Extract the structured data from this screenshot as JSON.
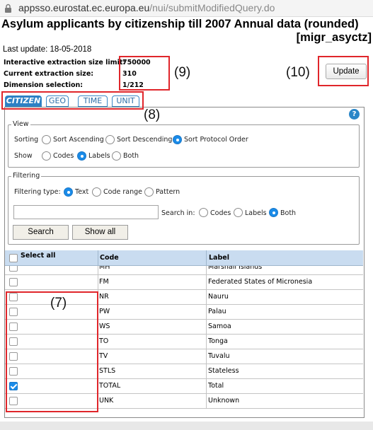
{
  "browser": {
    "url_host": "appsso.eurostat.ec.europa.eu",
    "url_path": "/nui/submitModifiedQuery.do"
  },
  "page": {
    "title": "Asylum applicants by citizenship till 2007 Annual data (rounded)",
    "dataset_code": "[migr_asyctz]",
    "last_update": "Last update: 18-05-2018"
  },
  "extraction": {
    "limit_label": "Interactive extraction size limit:",
    "limit_value": "750000",
    "current_label": "Current extraction size:",
    "current_value": "310",
    "selection_label": "Dimension selection:",
    "selection_value": "1/212"
  },
  "update_label": "Update",
  "annotations": {
    "a7": "(7)",
    "a8": "(8)",
    "a9": "(9)",
    "a10": "(10)"
  },
  "tabs": [
    {
      "label": "CITIZEN",
      "active": true
    },
    {
      "label": "GEO",
      "active": false
    },
    {
      "label": "TIME",
      "active": false
    },
    {
      "label": "UNIT",
      "active": false
    }
  ],
  "help_label": "?",
  "view": {
    "legend": "View",
    "sorting_label": "Sorting",
    "sorting_options": [
      "Sort Ascending",
      "Sort Descending",
      "Sort Protocol Order"
    ],
    "sorting_selected": "Sort Protocol Order",
    "show_label": "Show",
    "show_options": [
      "Codes",
      "Labels",
      "Both"
    ],
    "show_selected": "Labels"
  },
  "filtering": {
    "legend": "Filtering",
    "type_label": "Filtering type:",
    "type_options": [
      "Text",
      "Code range",
      "Pattern"
    ],
    "type_selected": "Text",
    "search_value": "",
    "search_in_label": "Search in:",
    "search_in_options": [
      "Codes",
      "Labels",
      "Both"
    ],
    "search_in_selected": "Both",
    "search_button": "Search",
    "show_all_button": "Show all"
  },
  "table": {
    "select_all_label": "Select all",
    "code_header": "Code",
    "label_header": "Label",
    "rows": [
      {
        "code": "MH",
        "label": "Marshall Islands",
        "checked": false
      },
      {
        "code": "FM",
        "label": "Federated States of Micronesia",
        "checked": false
      },
      {
        "code": "NR",
        "label": "Nauru",
        "checked": false
      },
      {
        "code": "PW",
        "label": "Palau",
        "checked": false
      },
      {
        "code": "WS",
        "label": "Samoa",
        "checked": false
      },
      {
        "code": "TO",
        "label": "Tonga",
        "checked": false
      },
      {
        "code": "TV",
        "label": "Tuvalu",
        "checked": false
      },
      {
        "code": "STLS",
        "label": "Stateless",
        "checked": false
      },
      {
        "code": "TOTAL",
        "label": "Total",
        "checked": true
      },
      {
        "code": "UNK",
        "label": "Unknown",
        "checked": false
      }
    ]
  },
  "colors": {
    "annotation_box": "#e0262b",
    "tab_active": "#2c80c4",
    "header_bg": "#c9dcf0",
    "accent": "#1a8be8"
  }
}
